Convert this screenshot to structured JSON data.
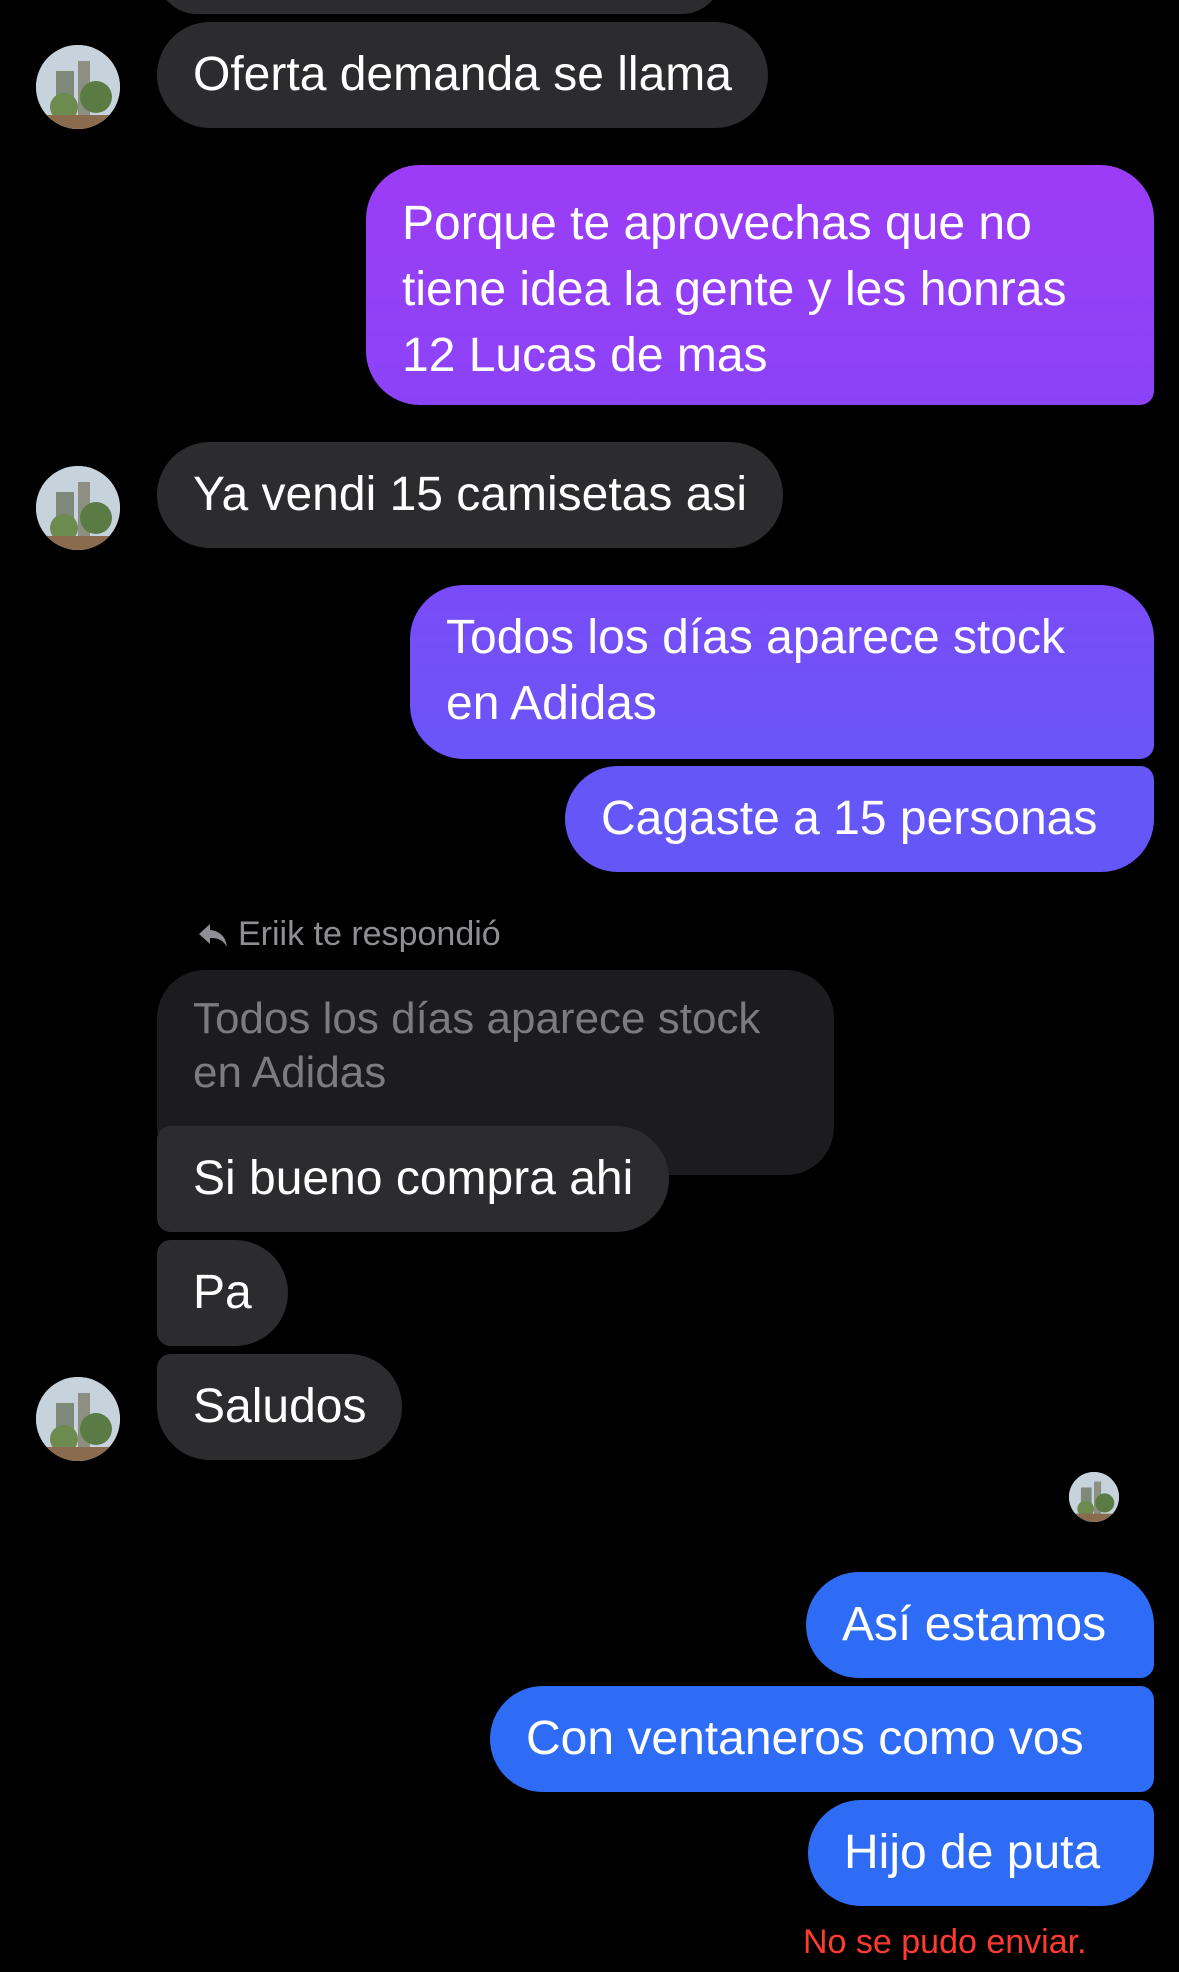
{
  "messages": {
    "m1": "Oferta demanda se llama",
    "m2_line1": "Porque te aprovechas que no",
    "m2_line2": "tiene idea la gente y les honras",
    "m2_line3": "12 Lucas de mas",
    "m3": "Ya vendi 15 camisetas asi",
    "m4_line1": "Todos los días aparece stock",
    "m4_line2": "en Adidas",
    "m5": "Cagaste a 15 personas",
    "reply_label": "Eriik te respondió",
    "quoted_line1": "Todos los días aparece stock",
    "quoted_line2": "en Adidas",
    "m6": "Si bueno compra ahi",
    "m7": "Pa",
    "m8": "Saludos",
    "m9": "Así estamos",
    "m10": "Con ventaneros como vos",
    "m11": "Hijo de puta",
    "error": "No se pudo enviar."
  },
  "colors": {
    "incoming": "#2c2c2e",
    "outgoing_purple": "#9a3cf5",
    "outgoing_violet": "#6a55f8",
    "outgoing_blue": "#2f6cf6",
    "error": "#ff3b30"
  },
  "icons": {
    "avatar": "avatar-icon",
    "reply": "reply-arrow-icon"
  }
}
